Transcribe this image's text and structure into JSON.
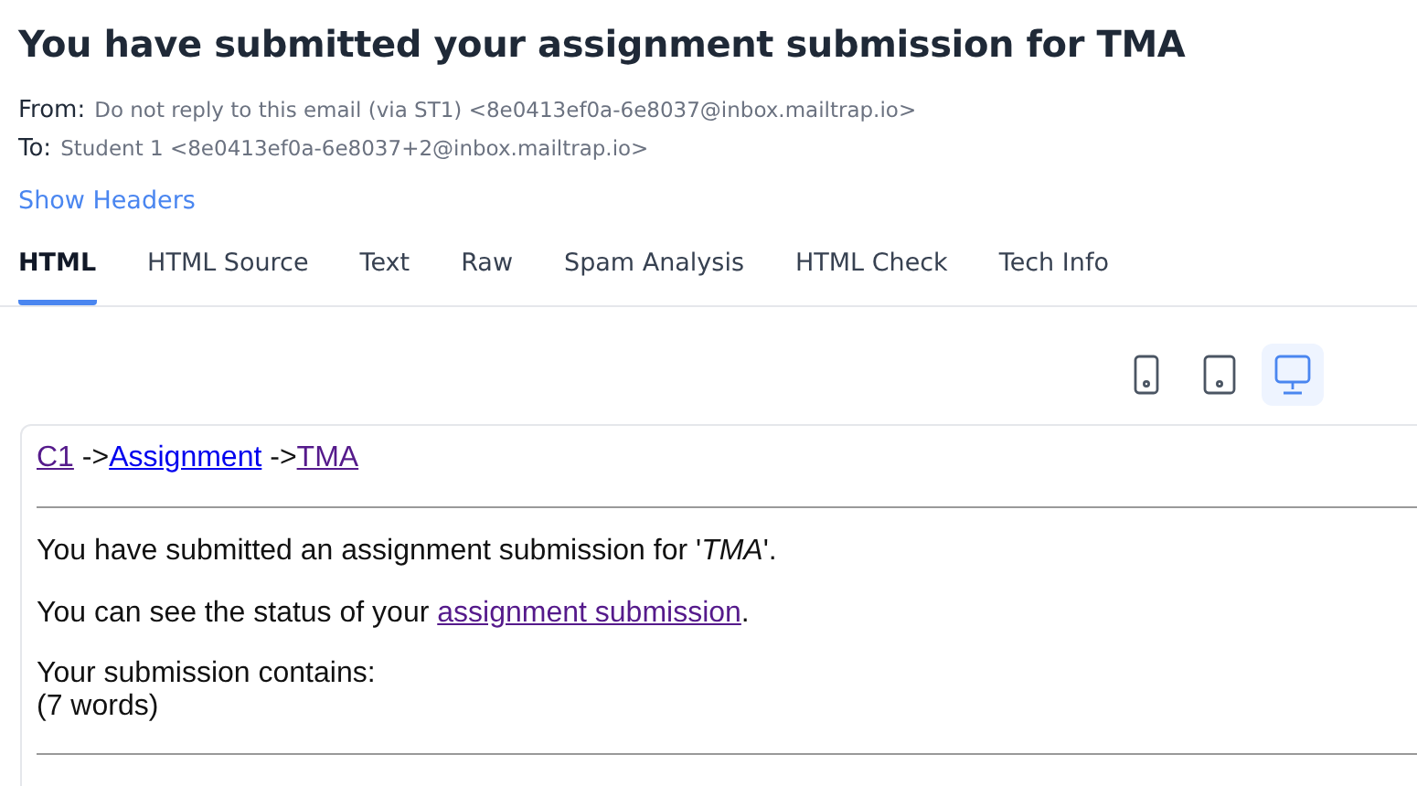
{
  "title": "You have submitted your assignment submission for TMA",
  "headers": [
    {
      "label": "From:",
      "value": "Do not reply to this email (via ST1) <8e0413ef0a-6e8037@inbox.mailtrap.io>"
    },
    {
      "label": "To:",
      "value": "Student 1 <8e0413ef0a-6e8037+2@inbox.mailtrap.io>"
    }
  ],
  "show_headers": "Show Headers",
  "tabs": [
    {
      "label": "HTML",
      "selected": true
    },
    {
      "label": "HTML Source",
      "selected": false
    },
    {
      "label": "Text",
      "selected": false
    },
    {
      "label": "Raw",
      "selected": false
    },
    {
      "label": "Spam Analysis",
      "selected": false
    },
    {
      "label": "HTML Check",
      "selected": false
    },
    {
      "label": "Tech Info",
      "selected": false
    }
  ],
  "devices": [
    {
      "kind": "phone",
      "selected": false
    },
    {
      "kind": "tablet",
      "selected": false
    },
    {
      "kind": "desktop",
      "selected": true
    }
  ],
  "email": {
    "breadcrumb": [
      {
        "label": "C1",
        "visited": true
      },
      {
        "label": "Assignment",
        "visited": false
      },
      {
        "label": "TMA",
        "visited": true
      }
    ],
    "separator": "->",
    "intro": "You have submitted an assignment submission for '*TMA*'.",
    "status": {
      "before": "You can see the status of your",
      "link": "assignment submission",
      "after": "."
    },
    "contains": [
      "Your submission contains:",
      "(7 words)"
    ]
  }
}
